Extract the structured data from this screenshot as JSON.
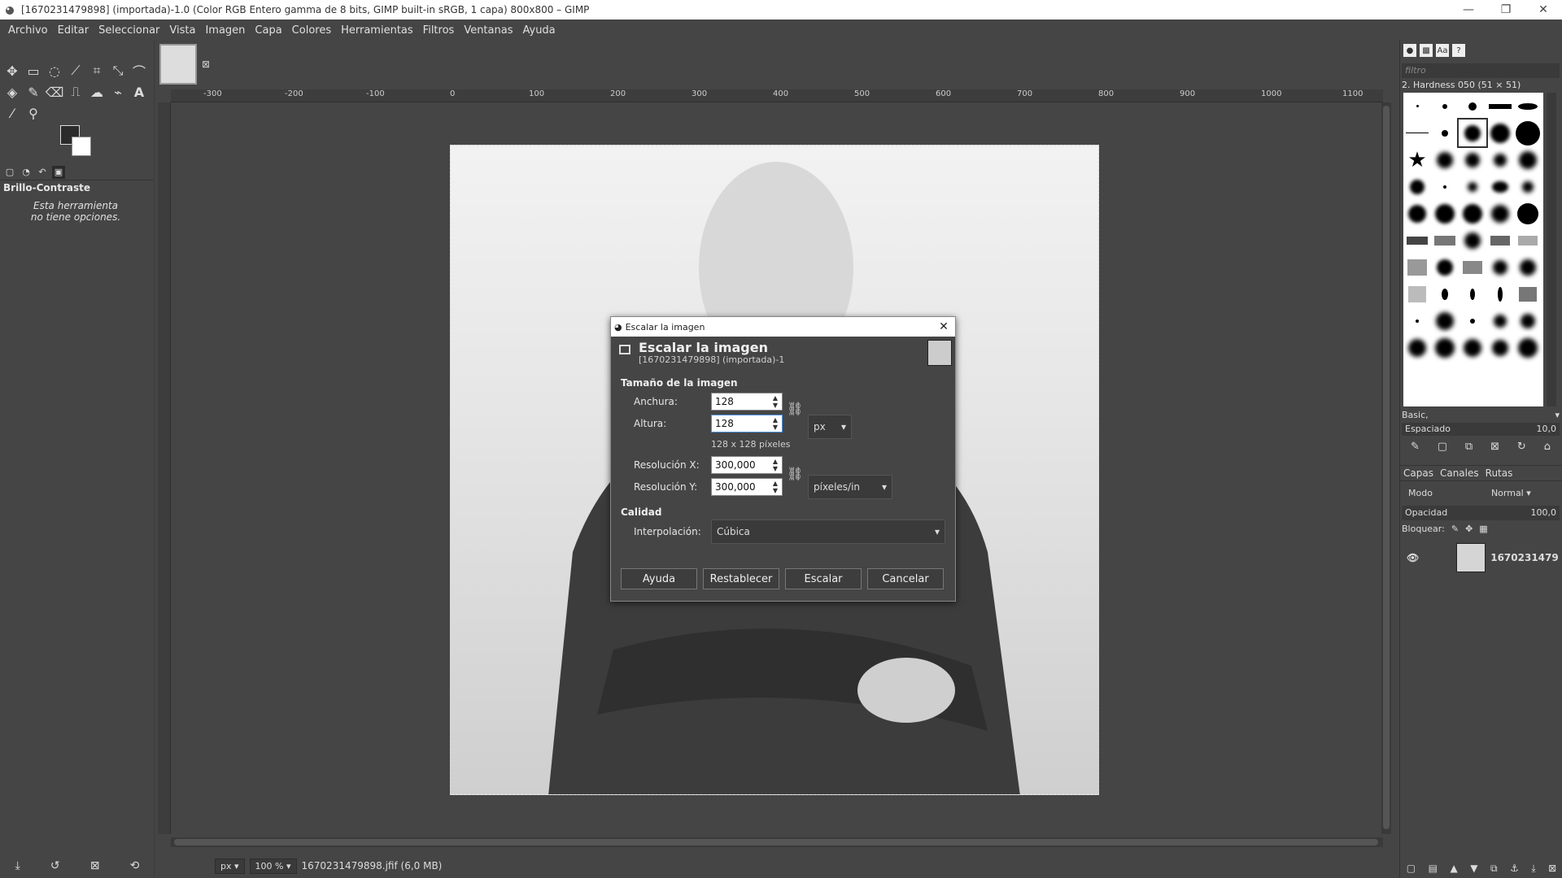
{
  "window": {
    "title": "[1670231479898] (importada)-1.0 (Color RGB Entero gamma de 8 bits, GIMP built-in sRGB, 1 capa) 800x800 – GIMP"
  },
  "menu": [
    "Archivo",
    "Editar",
    "Seleccionar",
    "Vista",
    "Imagen",
    "Capa",
    "Colores",
    "Herramientas",
    "Filtros",
    "Ventanas",
    "Ayuda"
  ],
  "tool_options": {
    "title": "Brillo-Contraste",
    "msg1": "Esta herramienta",
    "msg2": "no tiene opciones."
  },
  "ruler": [
    "-300",
    "-200",
    "-100",
    "0",
    "100",
    "200",
    "300",
    "400",
    "500",
    "600",
    "700",
    "800",
    "900",
    "1000",
    "1100"
  ],
  "status": {
    "unit": "px",
    "zoom": "100 %",
    "file": "1670231479898.jfif (6,0 MB)"
  },
  "brushes": {
    "filter_placeholder": "filtro",
    "selected": "2. Hardness 050 (51 × 51)",
    "set": "Basic,",
    "spacing_label": "Espaciado",
    "spacing_value": "10,0"
  },
  "layers": {
    "tabs": [
      "Capas",
      "Canales",
      "Rutas"
    ],
    "mode_label": "Modo",
    "mode_value": "Normal",
    "opacity_label": "Opacidad",
    "opacity_value": "100,0",
    "lock_label": "Bloquear:",
    "layer_name": "1670231479"
  },
  "dialog": {
    "window_title": "Escalar la imagen",
    "heading": "Escalar la imagen",
    "subheading": "[1670231479898] (importada)-1",
    "size_section": "Tamaño de la imagen",
    "width_label": "Anchura:",
    "width_value": "128",
    "height_label": "Altura:",
    "height_value": "128",
    "size_unit": "px",
    "pixels_note": "128 x 128 píxeles",
    "resx_label": "Resolución X:",
    "resx_value": "300,000",
    "resy_label": "Resolución Y:",
    "resy_value": "300,000",
    "res_unit": "píxeles/in",
    "quality_section": "Calidad",
    "interp_label": "Interpolación:",
    "interp_value": "Cúbica",
    "buttons": {
      "help": "Ayuda",
      "reset": "Restablecer",
      "scale": "Escalar",
      "cancel": "Cancelar"
    }
  }
}
